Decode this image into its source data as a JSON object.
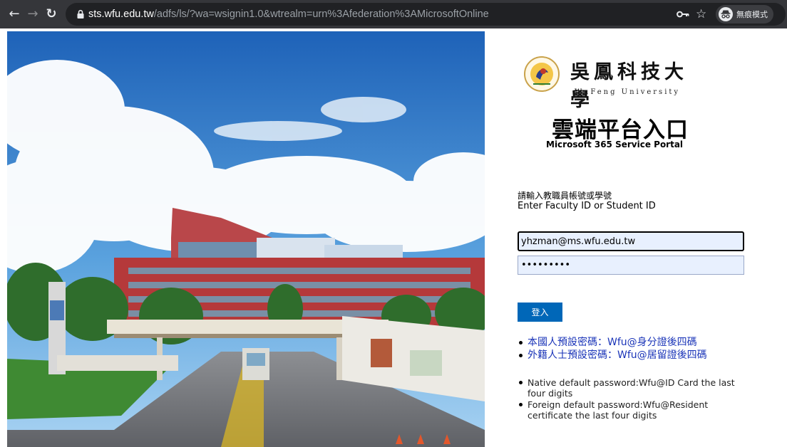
{
  "browser": {
    "url_host": "sts.wfu.edu.tw",
    "url_path": "/adfs/ls/?wa=wsignin1.0&wtrealm=urn%3Afederation%3AMicrosoftOnline",
    "incognito_label": "無痕模式",
    "icons": [
      "back-arrow-icon",
      "forward-arrow-icon",
      "reload-icon",
      "lock-icon",
      "key-icon",
      "star-icon",
      "incognito-icon"
    ]
  },
  "logo": {
    "name_cn": "吳鳳科技大學",
    "name_en": "WuFeng University"
  },
  "portal": {
    "title": "雲端平台入口",
    "subtitle": "Microsoft 365 Service Portal"
  },
  "login": {
    "prompt_cn": "請輸入教職員帳號或學號",
    "prompt_en": "Enter Faculty ID or Student ID",
    "username_value": "yhzman@ms.wfu.edu.tw",
    "password_mask": "•••••••••",
    "submit_label": "登入"
  },
  "notes_cn": [
    "本國人預設密碼：Wfu@身分證後四碼",
    "外籍人士預設密碼：Wfu@居留證後四碼"
  ],
  "notes_en": [
    "Native default password:Wfu@ID Card the last four digits",
    "Foreign default password:Wfu@Resident certificate the last four digits"
  ],
  "colors": {
    "chrome_bg": "#35363a",
    "button_blue": "#0067b8",
    "link_blue": "#1a34b8",
    "input_fill": "#e8f0fe"
  }
}
